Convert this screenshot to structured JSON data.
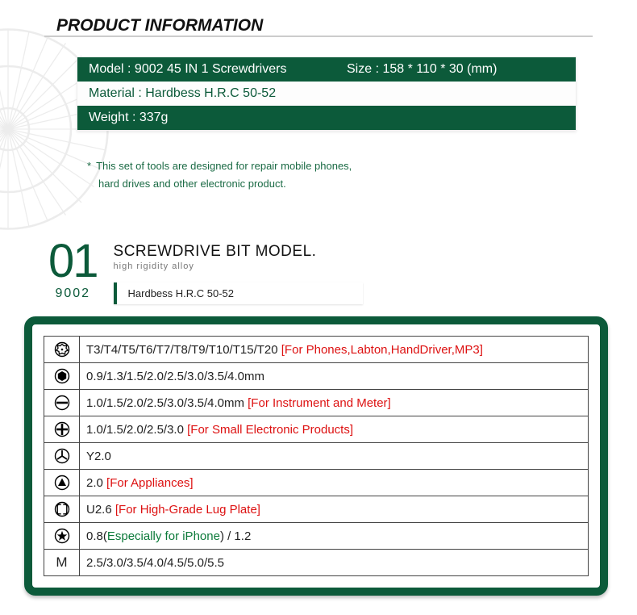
{
  "header": {
    "title": "PRODUCT INFORMATION"
  },
  "info": {
    "model": "Model : 9002 45 IN 1 Screwdrivers",
    "size": "Size : 158 * 110 * 30 (mm)",
    "material": "Material : Hardbess H.R.C 50-52",
    "weight": "Weight : 337g",
    "note_line1": "This set of tools are designed for repair mobile phones,",
    "note_line2": "hard drives and other electronic product."
  },
  "section": {
    "number": "01",
    "code": "9002",
    "title": "SCREWDRIVE BIT MODEL.",
    "subtitle": "high rigidity alloy",
    "tag": "Hardbess H.R.C 50-52"
  },
  "specs": [
    {
      "icon": "torx-security",
      "text": "T3/T4/T5/T6/T7/T8/T9/T10/T15/T20  ",
      "note": "[For Phones,Labton,HandDriver,MP3]",
      "note_class": "red"
    },
    {
      "icon": "hex",
      "text": "0.9/1.3/1.5/2.0/2.5/3.0/3.5/4.0mm",
      "note": "",
      "note_class": ""
    },
    {
      "icon": "slotted",
      "text": "1.0/1.5/2.0/2.5/3.0/3.5/4.0mm  ",
      "note": "[For Instrument and Meter]",
      "note_class": "red"
    },
    {
      "icon": "phillips",
      "text": "1.0/1.5/2.0/2.5/3.0  ",
      "note": "[For Small Electronic Products]",
      "note_class": "red"
    },
    {
      "icon": "tri-point",
      "text": "Y2.0",
      "note": "",
      "note_class": ""
    },
    {
      "icon": "triangle",
      "text": "2.0  ",
      "note": "[For Appliances]",
      "note_class": "red"
    },
    {
      "icon": "spanner",
      "text": "U2.6  ",
      "note": "[For High-Grade Lug Plate]",
      "note_class": "red"
    },
    {
      "icon": "pentalobe",
      "text_prefix": " 0.8(",
      "text_mid": "Especially for iPhone",
      "text_suffix": ") / 1.2"
    },
    {
      "icon": "m-letter",
      "text": "2.5/3.0/3.5/4.0/4.5/5.0/5.5",
      "note": "",
      "note_class": ""
    }
  ]
}
